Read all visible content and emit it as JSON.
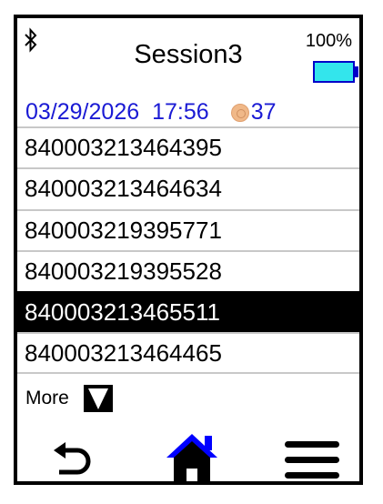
{
  "header": {
    "title": "Session3",
    "battery_percent": "100%",
    "battery_level": 1.0
  },
  "status": {
    "date": "03/29/2026",
    "time": "17:56",
    "count": "37"
  },
  "tags": [
    "840003213464395",
    "840003213464634",
    "840003219395771",
    "840003219395528",
    "840003213465511",
    "840003213464465"
  ],
  "selected_index": 4,
  "footer": {
    "more_label": "More"
  },
  "colors": {
    "accent_blue": "#0000ff",
    "status_text": "#1a1ad4",
    "battery_fill": "#33e5ec"
  },
  "icons": {
    "bluetooth": "bluetooth-icon",
    "back": "back-arrow-icon",
    "home": "home-icon",
    "menu": "hamburger-menu-icon",
    "more": "triangle-down-icon",
    "count": "coin-icon"
  }
}
